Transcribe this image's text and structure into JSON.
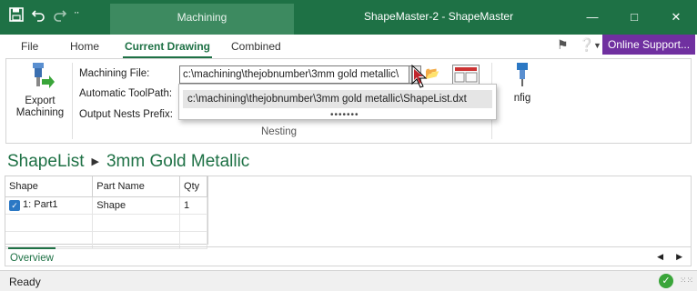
{
  "titlebar": {
    "context_tab": "Machining",
    "title": "ShapeMaster-2 - ShapeMaster",
    "qat_more": "¨"
  },
  "ribbon_tabs": [
    "File",
    "Home",
    "Current Drawing",
    "Combined"
  ],
  "online_support": "Online Support...",
  "ribbon": {
    "export_label_1": "Export",
    "export_label_2": "Machining",
    "machining_file_label": "Machining File:",
    "machining_file_value": "c:\\machining\\thejobnumber\\3mm gold metallic\\",
    "auto_toolpath_label": "Automatic ToolPath:",
    "output_prefix_label": "Output Nests Prefix:",
    "group_label": "Nesting",
    "config_label": "nfig"
  },
  "dropdown": {
    "item": "c:\\machining\\thejobnumber\\3mm gold metallic\\ShapeList.dxt",
    "grip": "•••••••"
  },
  "breadcrumb": {
    "root": "ShapeList",
    "current": "3mm Gold Metallic"
  },
  "grid": {
    "headers": [
      "Shape",
      "Part Name",
      "Qty"
    ],
    "rows": [
      {
        "shape": "1: Part1",
        "part_name": "Shape",
        "qty": "1"
      }
    ]
  },
  "overview_tab": "Overview",
  "status": "Ready",
  "colors": {
    "accent": "#1e7145",
    "support": "#7030a0"
  }
}
